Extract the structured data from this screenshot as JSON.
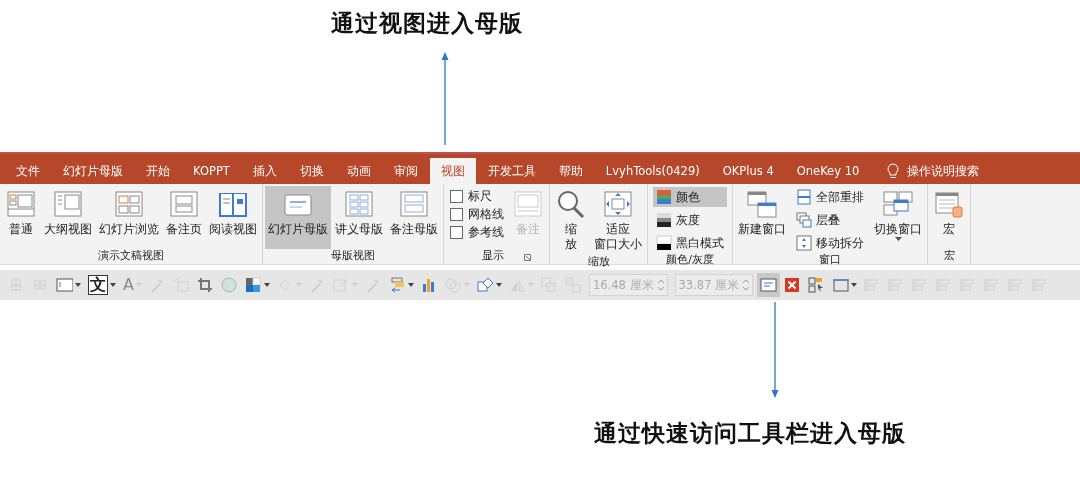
{
  "top_caption": "通过视图进入母版",
  "tabs": [
    {
      "label": "文件",
      "selected": false
    },
    {
      "label": "幻灯片母版",
      "selected": false
    },
    {
      "label": "开始",
      "selected": false
    },
    {
      "label": "KOPPT",
      "selected": false
    },
    {
      "label": "插入",
      "selected": false
    },
    {
      "label": "切换",
      "selected": false
    },
    {
      "label": "动画",
      "selected": false
    },
    {
      "label": "审阅",
      "selected": false
    },
    {
      "label": "视图",
      "selected": true
    },
    {
      "label": "开发工具",
      "selected": false
    },
    {
      "label": "帮助",
      "selected": false
    },
    {
      "label": "LvyhTools(0429)",
      "selected": false
    },
    {
      "label": "OKPlus 4",
      "selected": false
    },
    {
      "label": "OneKey 10",
      "selected": false
    }
  ],
  "tell_me": "操作说明搜索",
  "groups": [
    {
      "label": "演示文稿视图",
      "items": [
        {
          "kind": "large",
          "lines": [
            "普通"
          ],
          "selected": false,
          "disabled": false
        },
        {
          "kind": "large",
          "lines": [
            "大纲视图"
          ],
          "selected": false,
          "disabled": false
        },
        {
          "kind": "large",
          "lines": [
            "幻灯片浏览"
          ],
          "selected": false,
          "disabled": false
        },
        {
          "kind": "large",
          "lines": [
            "备注页"
          ],
          "selected": false,
          "disabled": false
        },
        {
          "kind": "large",
          "lines": [
            "阅读视图"
          ],
          "selected": false,
          "disabled": false
        }
      ]
    },
    {
      "label": "母版视图",
      "items": [
        {
          "kind": "large",
          "lines": [
            "幻灯片母版"
          ],
          "selected": true,
          "disabled": false
        },
        {
          "kind": "large",
          "lines": [
            "讲义母版"
          ],
          "selected": false,
          "disabled": false
        },
        {
          "kind": "large",
          "lines": [
            "备注母版"
          ],
          "selected": false,
          "disabled": false
        }
      ]
    },
    {
      "label": "显示",
      "launcher": true,
      "items": [
        {
          "kind": "checks",
          "items": [
            {
              "label": "标尺",
              "checked": false
            },
            {
              "label": "网格线",
              "checked": false
            },
            {
              "label": "参考线",
              "checked": false
            }
          ]
        },
        {
          "kind": "large",
          "lines": [
            "备注"
          ],
          "selected": false,
          "disabled": true
        }
      ]
    },
    {
      "label": "缩放",
      "items": [
        {
          "kind": "large",
          "lines": [
            "缩",
            "放"
          ],
          "selected": false,
          "disabled": false
        },
        {
          "kind": "large",
          "lines": [
            "适应",
            "窗口大小"
          ],
          "selected": false,
          "disabled": false
        }
      ]
    },
    {
      "label": "颜色/灰度",
      "items": [
        {
          "kind": "smalls",
          "items": [
            {
              "label": "颜色",
              "selected": true
            },
            {
              "label": "灰度",
              "selected": false
            },
            {
              "label": "黑白模式",
              "selected": false
            }
          ]
        }
      ]
    },
    {
      "label": "窗口",
      "items": [
        {
          "kind": "large",
          "lines": [
            "新建窗口"
          ],
          "selected": false,
          "disabled": false
        },
        {
          "kind": "smalls",
          "items": [
            {
              "label": "全部重排",
              "selected": false
            },
            {
              "label": "层叠",
              "selected": false
            },
            {
              "label": "移动拆分",
              "selected": false
            }
          ]
        },
        {
          "kind": "large",
          "lines": [
            "切换窗口"
          ],
          "dropdown": true,
          "selected": false,
          "disabled": false
        }
      ]
    },
    {
      "label": "宏",
      "items": [
        {
          "kind": "large",
          "lines": [
            "宏"
          ],
          "selected": false,
          "disabled": false
        }
      ]
    }
  ],
  "toolbar": [
    {
      "kind": "button",
      "disabled": true
    },
    {
      "kind": "button",
      "disabled": true
    },
    {
      "kind": "split",
      "disabled": false
    },
    {
      "kind": "glyph",
      "text": "文",
      "split": true,
      "disabled": false
    },
    {
      "kind": "glyph",
      "text": "A",
      "split": true,
      "disabled": true
    },
    {
      "kind": "button",
      "disabled": true
    },
    {
      "kind": "button",
      "disabled": true
    },
    {
      "kind": "button",
      "disabled": false
    },
    {
      "kind": "button",
      "disabled": false
    },
    {
      "kind": "split",
      "disabled": false
    },
    {
      "kind": "split",
      "disabled": true
    },
    {
      "kind": "button",
      "disabled": true
    },
    {
      "kind": "split",
      "disabled": true
    },
    {
      "kind": "button",
      "disabled": true
    },
    {
      "kind": "split",
      "disabled": false
    },
    {
      "kind": "button",
      "disabled": false
    },
    {
      "kind": "split",
      "disabled": true
    },
    {
      "kind": "split",
      "disabled": false
    },
    {
      "kind": "split",
      "disabled": true
    },
    {
      "kind": "button",
      "disabled": true
    },
    {
      "kind": "button",
      "disabled": true
    },
    {
      "kind": "field",
      "value": "16.48 厘米",
      "disabled": true
    },
    {
      "kind": "field",
      "value": "33.87 厘米",
      "disabled": true
    },
    {
      "kind": "button",
      "disabled": false,
      "selected": true
    },
    {
      "kind": "button",
      "disabled": false
    },
    {
      "kind": "button",
      "disabled": false
    },
    {
      "kind": "split",
      "disabled": false
    },
    {
      "kind": "button",
      "disabled": true
    },
    {
      "kind": "button",
      "disabled": true
    },
    {
      "kind": "button",
      "disabled": true
    },
    {
      "kind": "button",
      "disabled": true
    },
    {
      "kind": "button",
      "disabled": true
    },
    {
      "kind": "button",
      "disabled": true
    },
    {
      "kind": "button",
      "disabled": true
    },
    {
      "kind": "button",
      "disabled": true
    }
  ],
  "bottom_caption": "通过快速访问工具栏进入母版"
}
